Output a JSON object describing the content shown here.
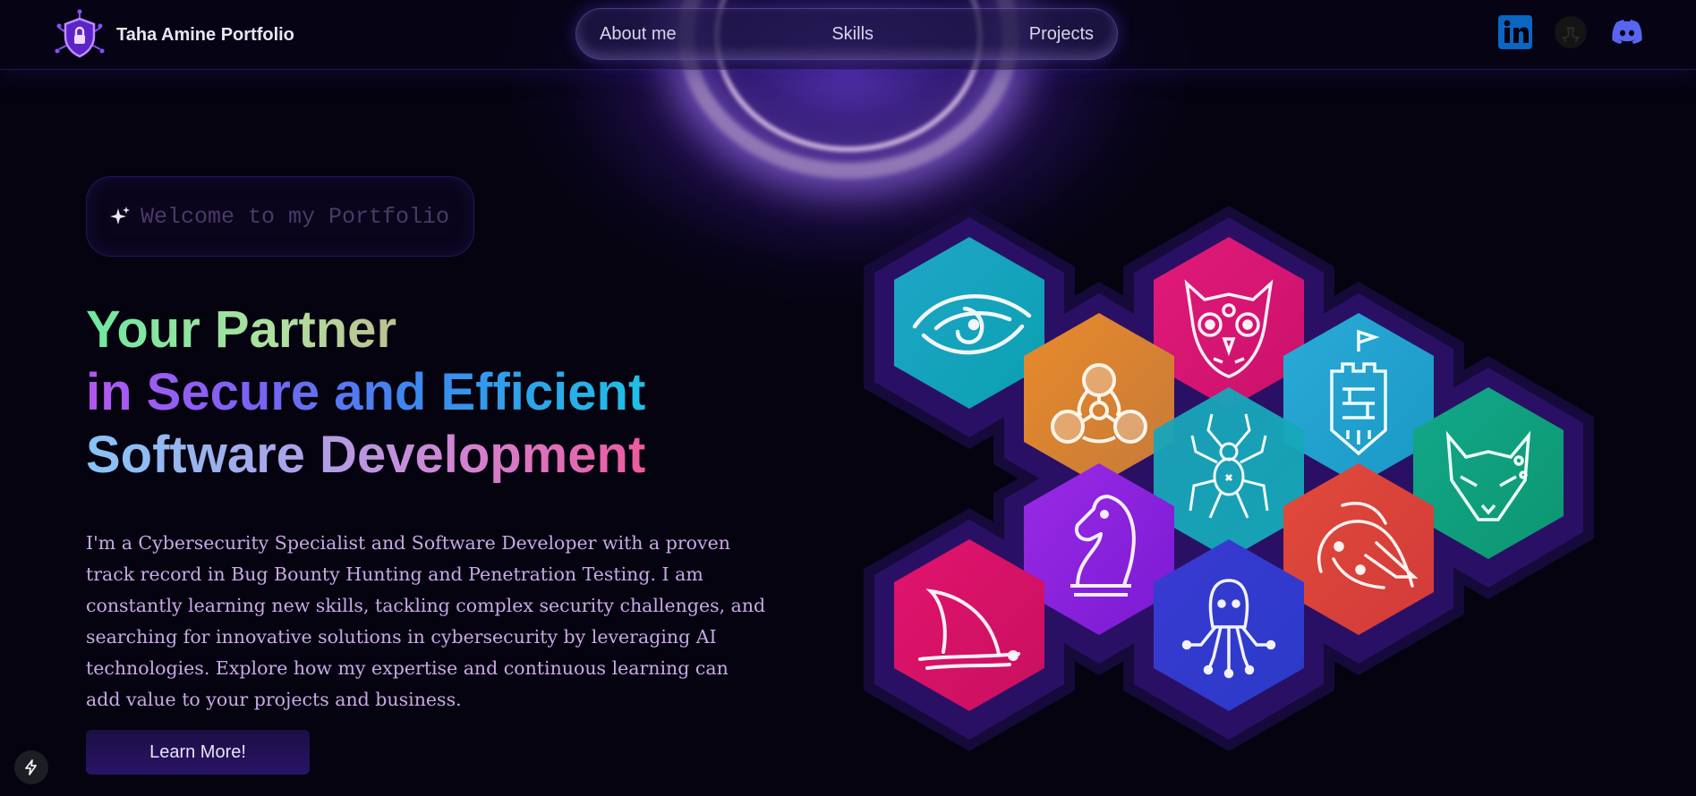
{
  "brand": {
    "title": "Taha Amine Portfolio",
    "logo_icon": "shield-lock-circuit-icon"
  },
  "nav": {
    "items": [
      {
        "label": "About me"
      },
      {
        "label": "Skills"
      },
      {
        "label": "Projects"
      }
    ]
  },
  "social": [
    {
      "name": "linkedin",
      "icon": "linkedin-icon",
      "color": "#0a66c2"
    },
    {
      "name": "github",
      "icon": "github-icon",
      "color": "#1a1a1a"
    },
    {
      "name": "discord",
      "icon": "discord-icon",
      "color": "#5865f2"
    }
  ],
  "hero": {
    "badge_icon": "sparkles-icon",
    "badge_text": "Welcome to my Portfolio",
    "title_line1": "Your Partner",
    "title_line2": "in Secure and Efficient",
    "title_line3": "Software Development",
    "description": "I'm a Cybersecurity Specialist and Software Developer with a proven track record in Bug Bounty Hunting and Penetration Testing. I am constantly learning new skills, tackling complex security challenges, and searching for innovative solutions in cybersecurity by leveraging AI technologies. Explore how my expertise and continuous learning can add value to your projects and business.",
    "cta_label": "Learn More!"
  },
  "hex_grid": [
    {
      "icon": "eye-icon",
      "color_from": "#1fa6c8",
      "color_to": "#0aa0b0"
    },
    {
      "icon": "owl-icon",
      "color_from": "#e21a7a",
      "color_to": "#c9116a"
    },
    {
      "icon": "biohazard-network-icon",
      "color_from": "#e88a2a",
      "color_to": "#c67a3a"
    },
    {
      "icon": "castle-tower-icon",
      "color_from": "#2aaad6",
      "color_to": "#1a98c6"
    },
    {
      "icon": "spider-icon",
      "color_from": "#1aa4ba",
      "color_to": "#14aab8"
    },
    {
      "icon": "fox-icon",
      "color_from": "#12a88a",
      "color_to": "#0d9670"
    },
    {
      "icon": "chess-knight-icon",
      "color_from": "#9a2ae6",
      "color_to": "#7a1ad2"
    },
    {
      "icon": "dragon-icon",
      "color_from": "#e14a3a",
      "color_to": "#d23a3a"
    },
    {
      "icon": "shark-fin-icon",
      "color_from": "#e2146e",
      "color_to": "#c8105e"
    },
    {
      "icon": "octopus-circuit-icon",
      "color_from": "#3a3ad2",
      "color_to": "#2a3ac8"
    }
  ],
  "footer": {
    "badge_icon": "bolt-icon"
  }
}
